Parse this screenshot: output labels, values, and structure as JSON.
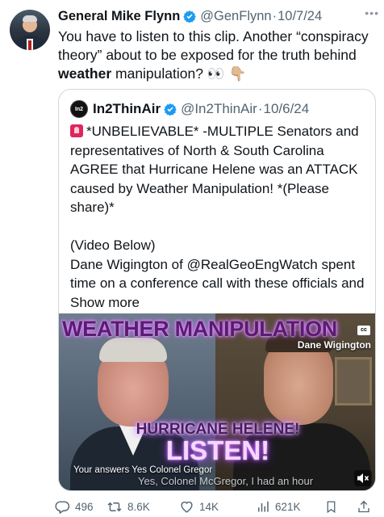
{
  "post": {
    "author_name": "General Mike Flynn",
    "handle": "@GenFlynn",
    "separator": "·",
    "date": "10/7/24",
    "text_before": "You have to listen to this clip. Another “conspiracy theory” about to be exposed for the truth behind ",
    "text_bold": "weather",
    "text_after": " manipulation? 👀 👇🏼"
  },
  "quote": {
    "avatar_label": "In2",
    "author_name": "In2ThinAir",
    "handle": "@In2ThinAir",
    "separator": "·",
    "date": "10/6/24",
    "line1": "*UNBELIEVABLE* -MULTIPLE Senators and representatives of North & South Carolina AGREE that Hurricane Helene was an ATTACK caused by Weather Manipulation! *(Please share)*",
    "line2": "(Video Below)",
    "line3": "Dane Wigington of @RealGeoEngWatch spent time on a conference call with these officials and Show more"
  },
  "video": {
    "title": "WEATHER MANIPULATION",
    "cc_label": "cc",
    "speaker_name": "Dane Wigington",
    "subtitle_small": "HURRICANE HELENE!",
    "subtitle_big": "LISTEN!",
    "answers_text": "Your answers Yes Colonel Gregor",
    "caption": "Yes, Colonel McGregor, I had an hour"
  },
  "actions": {
    "replies": "496",
    "reposts": "8.6K",
    "likes": "14K",
    "views": "621K"
  },
  "colors": {
    "text": "#0f1419",
    "secondary": "#536471",
    "verified": "#1d9bf0",
    "border": "#cfd9de",
    "glow": "#c060ff"
  },
  "icons": [
    "verified-badge-icon",
    "more-icon",
    "siren-icon",
    "cc-icon",
    "mute-icon",
    "reply-icon",
    "repost-icon",
    "like-icon",
    "views-icon",
    "bookmark-icon",
    "share-icon"
  ]
}
